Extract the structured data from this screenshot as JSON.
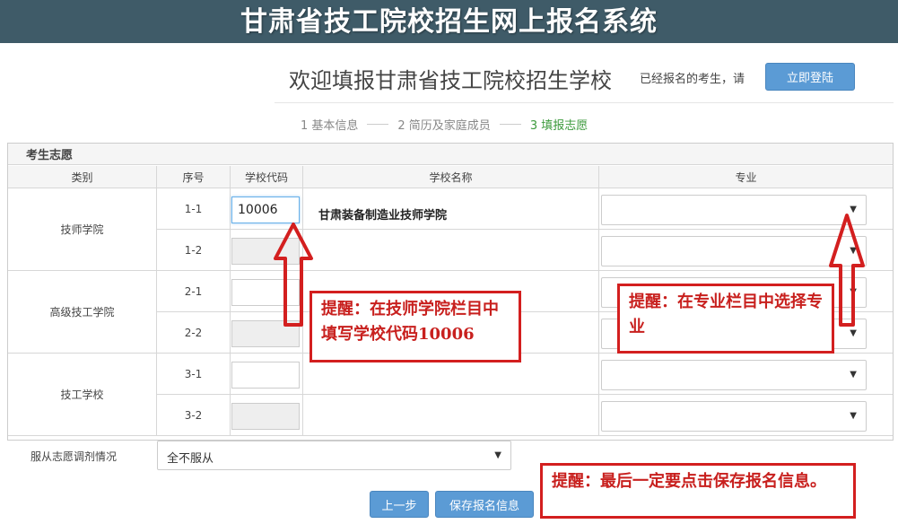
{
  "header": {
    "title": "甘肃省技工院校招生网上报名系统"
  },
  "welcome": {
    "title": "欢迎填报甘肃省技工院校招生学校",
    "already_registered": "已经报名的考生，请",
    "login_label": "立即登陆"
  },
  "steps": [
    {
      "label": "1 基本信息",
      "active": false
    },
    {
      "label": "2 简历及家庭成员",
      "active": false
    },
    {
      "label": "3 填报志愿",
      "active": true
    }
  ],
  "form": {
    "section_title": "考生志愿",
    "columns": [
      "类别",
      "序号",
      "学校代码",
      "学校名称",
      "专业"
    ],
    "categories": [
      "技师学院",
      "高级技工学院",
      "技工学校"
    ],
    "rows": [
      {
        "seq": "1-1",
        "code": "10006",
        "school": "甘肃装备制造业技师学院"
      },
      {
        "seq": "1-2",
        "code": "",
        "school": ""
      },
      {
        "seq": "2-1",
        "code": "",
        "school": ""
      },
      {
        "seq": "2-2",
        "code": "",
        "school": ""
      },
      {
        "seq": "3-1",
        "code": "",
        "school": ""
      },
      {
        "seq": "3-2",
        "code": "",
        "school": ""
      }
    ],
    "obey_label": "服从志愿调剂情况",
    "obey_value": "全不服从",
    "dropdown_arrow": "▼"
  },
  "buttons": {
    "prev": "上一步",
    "save": "保存报名信息"
  },
  "notes": {
    "code": "提醒：在技师学院栏目中填写学校代码10006",
    "major": "提醒：在专业栏目中选择专业",
    "save": "提醒：最后一定要点击保存报名信息。"
  },
  "colors": {
    "banner": "#3f5b68",
    "button": "#5b9bd5",
    "annotation": "#d31f1f",
    "active_step": "#3c9a3c"
  }
}
